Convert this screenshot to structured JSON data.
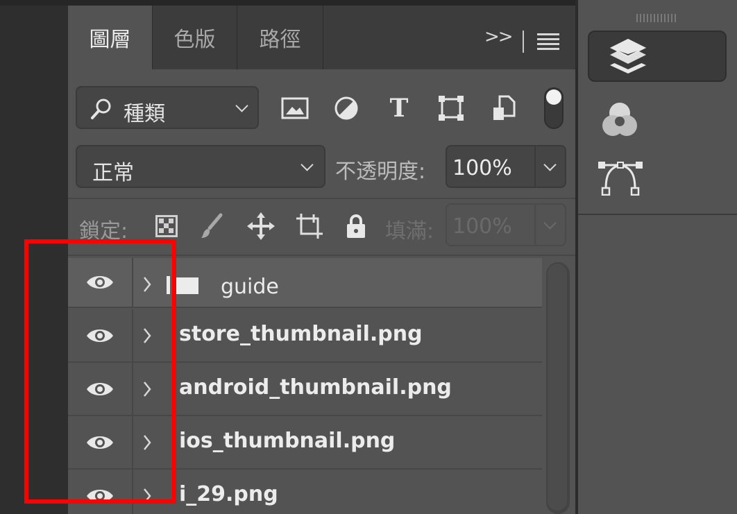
{
  "tabs": [
    {
      "label": "圖層",
      "active": true
    },
    {
      "label": "色版",
      "active": false
    },
    {
      "label": "路徑",
      "active": false
    }
  ],
  "tab_controls": {
    "collapse_label": ">>"
  },
  "filter": {
    "label": "種類"
  },
  "blend": {
    "mode": "正常",
    "opacity_label": "不透明度:",
    "opacity_value": "100%"
  },
  "lock": {
    "label": "鎖定:",
    "fill_label": "填滿:",
    "fill_value": "100%"
  },
  "layers": [
    {
      "name": "guide",
      "type": "group",
      "visible": true
    },
    {
      "name": "store_thumbnail.png",
      "type": "layer",
      "visible": true
    },
    {
      "name": "android_thumbnail.png",
      "type": "layer",
      "visible": true
    },
    {
      "name": "ios_thumbnail.png",
      "type": "layer",
      "visible": true
    },
    {
      "name": "i_29.png",
      "type": "layer",
      "visible": true
    }
  ],
  "annotation": {
    "color": "#ff0000"
  },
  "right_panel": {
    "icons": [
      "layers-panel-icon",
      "channels-panel-icon",
      "paths-panel-icon"
    ]
  }
}
